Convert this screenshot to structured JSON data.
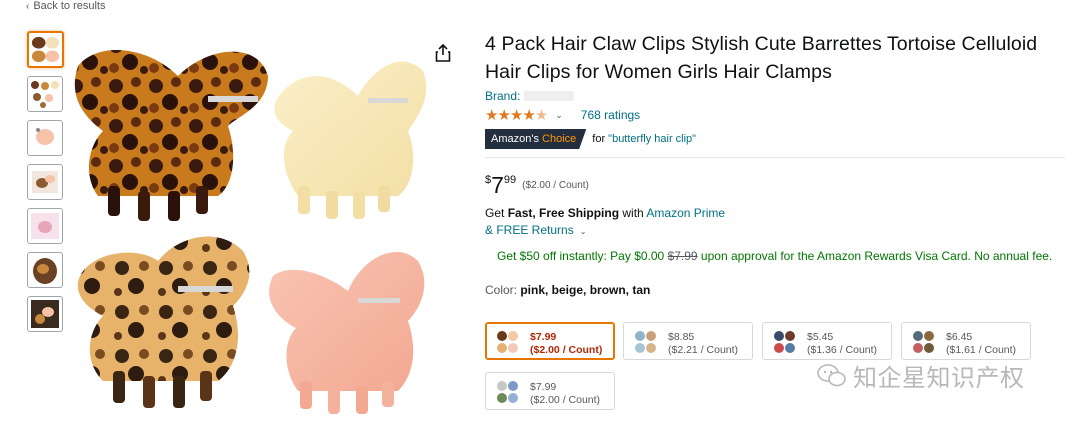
{
  "nav": {
    "back_label": "Back to results",
    "back_icon": "chevron-left-icon"
  },
  "gallery": {
    "thumbnails": [
      {
        "name": "thumb-1",
        "selected": true
      },
      {
        "name": "thumb-2",
        "selected": false
      },
      {
        "name": "thumb-3",
        "selected": false
      },
      {
        "name": "thumb-4",
        "selected": false
      },
      {
        "name": "thumb-5",
        "selected": false
      },
      {
        "name": "thumb-6",
        "selected": false
      },
      {
        "name": "thumb-7",
        "selected": false
      }
    ],
    "share_icon": "share-icon"
  },
  "product": {
    "title": "4 Pack Hair Claw Clips Stylish Cute Barrettes Tortoise Celluloid Hair Clips for Women Girls Hair Clamps",
    "brand_label": "Brand:",
    "rating_stars": 4.5,
    "ratings_count": "768 ratings",
    "badge": {
      "part1": "Amazon's ",
      "part2": "Choice"
    },
    "badge_for": "for ",
    "badge_keyword": "\"butterfly hair clip\"",
    "price": {
      "symbol": "$",
      "whole": "7",
      "fraction": "99",
      "unit": "($2.00 / Count)"
    },
    "shipping": {
      "get": "Get ",
      "bold": "Fast, Free Shipping",
      "with": " with ",
      "prime": "Amazon Prime"
    },
    "returns": "& FREE Returns",
    "promo": {
      "text1": "Get $50 off instantly: Pay $0.00 ",
      "strike": "$7.99",
      "text2": " upon approval for the Amazon Rewards Visa Card. No annual fee."
    },
    "color": {
      "label": "Color: ",
      "value": "pink, beige, brown, tan"
    },
    "variants": [
      {
        "price": "$7.99",
        "unit": "($2.00 / Count)",
        "selected": true,
        "colors": [
          "#6b3a1c",
          "#f2c9a0",
          "#e7b070",
          "#f4c8b6"
        ]
      },
      {
        "price": "$8.85",
        "unit": "($2.21 / Count)",
        "selected": false,
        "colors": [
          "#8fb3c9",
          "#c9a27a",
          "#a5c4d4",
          "#d8b48a"
        ]
      },
      {
        "price": "$5.45",
        "unit": "($1.36 / Count)",
        "selected": false,
        "colors": [
          "#3b4a6b",
          "#6e3a2a",
          "#c84a4a",
          "#5a7aa8"
        ]
      },
      {
        "price": "$6.45",
        "unit": "($1.61 / Count)",
        "selected": false,
        "colors": [
          "#556b7a",
          "#8a6a3a",
          "#c06060",
          "#6f5a3a"
        ]
      },
      {
        "price": "$7.99",
        "unit": "($2.00 / Count)",
        "selected": false,
        "colors": [
          "#c7c7c7",
          "#7a9cc6",
          "#6e8a5a",
          "#93b0d6"
        ]
      }
    ]
  },
  "watermark": "知企星知识产权"
}
